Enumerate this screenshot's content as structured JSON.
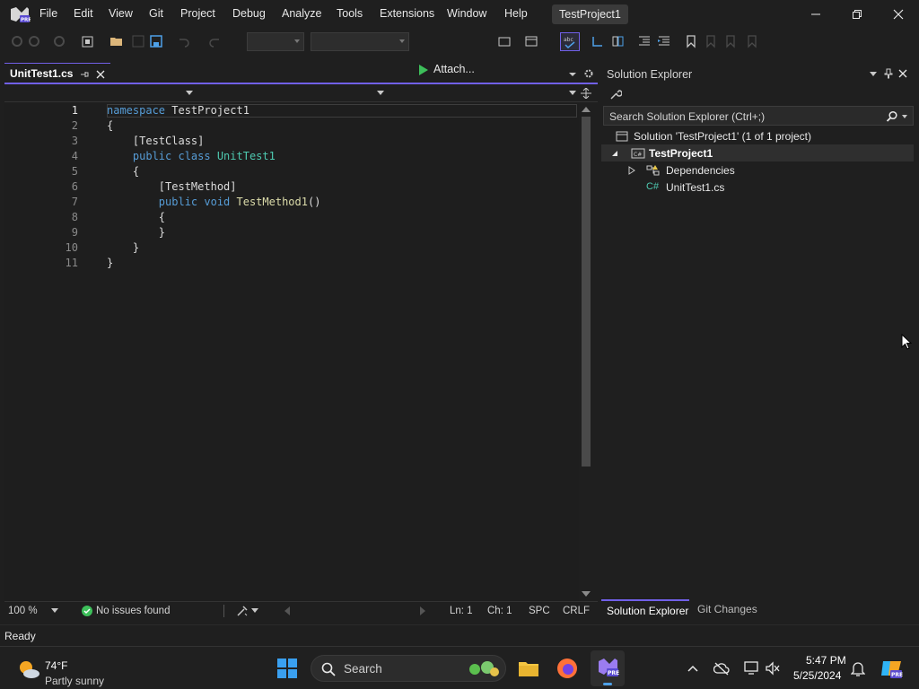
{
  "menu": [
    "File",
    "Edit",
    "View",
    "Git",
    "Project",
    "Debug",
    "Analyze",
    "Tools",
    "Extensions",
    "Window",
    "Help"
  ],
  "title": "TestProject1",
  "toolbar": {
    "attach_label": "Attach..."
  },
  "editor": {
    "tab_label": "UnitTest1.cs",
    "line_numbers": [
      "1",
      "2",
      "3",
      "4",
      "5",
      "6",
      "7",
      "8",
      "9",
      "10",
      "11"
    ],
    "lines": [
      {
        "kw": "namespace",
        "ty": "",
        "rest": " TestProject1"
      },
      {
        "kw": "",
        "ty": "",
        "rest": "{"
      },
      {
        "kw": "",
        "ty": "",
        "rest": "    [TestClass]"
      },
      {
        "kw": "    public class",
        "ty": " UnitTest1",
        "rest": ""
      },
      {
        "kw": "",
        "ty": "",
        "rest": "    {"
      },
      {
        "kw": "",
        "ty": "",
        "rest": "        [TestMethod]"
      },
      {
        "kw": "        public void",
        "ty": "",
        "fn": " TestMethod1",
        "rest": "()"
      },
      {
        "kw": "",
        "ty": "",
        "rest": "        {"
      },
      {
        "kw": "",
        "ty": "",
        "rest": "        }"
      },
      {
        "kw": "",
        "ty": "",
        "rest": "    }"
      },
      {
        "kw": "",
        "ty": "",
        "rest": "}"
      }
    ],
    "status": {
      "zoom": "100 %",
      "issues": "No issues found",
      "line": "Ln: 1",
      "col": "Ch: 1",
      "spacing": "SPC",
      "eol": "CRLF"
    }
  },
  "solution_explorer": {
    "title": "Solution Explorer",
    "search_placeholder": "Search Solution Explorer (Ctrl+;)",
    "solution": "Solution 'TestProject1' (1 of 1 project)",
    "project": "TestProject1",
    "dependencies": "Dependencies",
    "file": "UnitTest1.cs",
    "tabs": [
      "Solution Explorer",
      "Git Changes"
    ]
  },
  "status_bar": {
    "text": "Ready"
  },
  "taskbar": {
    "weather_temp": "74°F",
    "weather_desc": "Partly sunny",
    "search_label": "Search",
    "time": "5:47 PM",
    "date": "5/25/2024"
  },
  "colors": {
    "accent": "#7160e8",
    "keyword": "#569cd6",
    "type": "#4ec9b0",
    "method": "#dcdcaa"
  }
}
